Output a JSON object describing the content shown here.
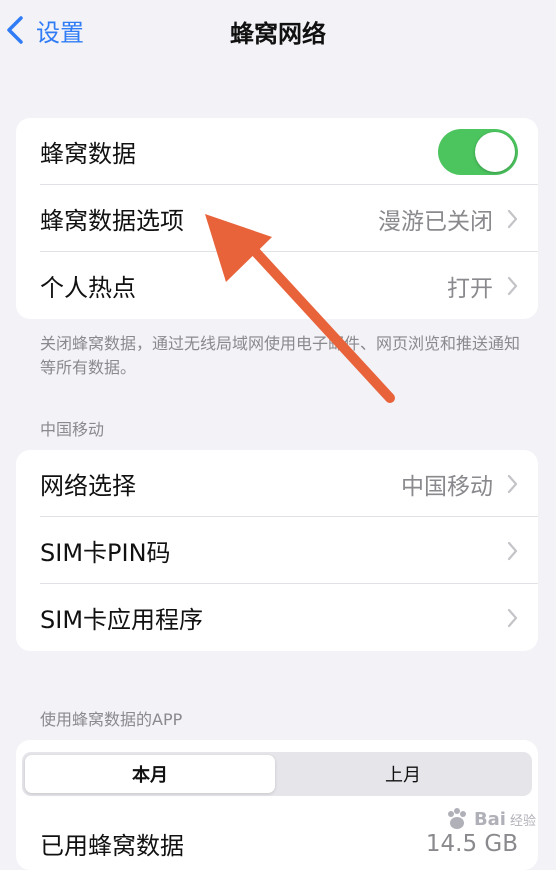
{
  "nav": {
    "back_label": "设置",
    "title": "蜂窝网络"
  },
  "group1": {
    "cellular_data": {
      "label": "蜂窝数据",
      "toggle_on": true
    },
    "cellular_data_options": {
      "label": "蜂窝数据选项",
      "value": "漫游已关闭"
    },
    "personal_hotspot": {
      "label": "个人热点",
      "value": "打开"
    }
  },
  "footnote": "关闭蜂窝数据，通过无线局域网使用电子邮件、网页浏览和推送通知等所有数据。",
  "carrier": {
    "header": "中国移动",
    "network_selection": {
      "label": "网络选择",
      "value": "中国移动"
    },
    "sim_pin": {
      "label": "SIM卡PIN码"
    },
    "sim_apps": {
      "label": "SIM卡应用程序"
    }
  },
  "usage": {
    "header": "使用蜂窝数据的APP",
    "tabs": [
      {
        "label": "本月"
      },
      {
        "label": "上月"
      }
    ],
    "used_data": {
      "label": "已用蜂窝数据",
      "value": "14.5 GB"
    }
  },
  "watermark": {
    "brand": "Bai",
    "sub": "经验"
  },
  "colors": {
    "accent": "#2f7cf6",
    "toggle_on": "#4cc55f",
    "annotation_arrow": "#e8623a"
  }
}
